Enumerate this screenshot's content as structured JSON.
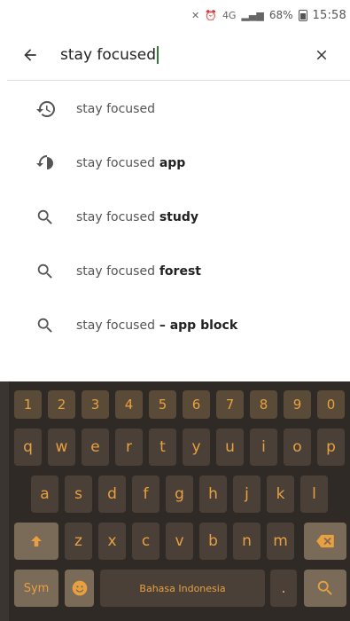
{
  "status": {
    "signal_text": "4G",
    "battery_percent": "68%",
    "time": "15:58"
  },
  "search": {
    "query": "stay focused"
  },
  "suggestions": [
    {
      "type": "history",
      "prefix": "stay focused",
      "suffix": ""
    },
    {
      "type": "history",
      "prefix": "stay focused",
      "suffix": " app"
    },
    {
      "type": "search",
      "prefix": "stay focused",
      "suffix": " study"
    },
    {
      "type": "search",
      "prefix": "stay focused",
      "suffix": " forest"
    },
    {
      "type": "search",
      "prefix": "stay focused",
      "suffix": " – app block"
    }
  ],
  "keyboard": {
    "row_numbers": [
      "1",
      "2",
      "3",
      "4",
      "5",
      "6",
      "7",
      "8",
      "9",
      "0"
    ],
    "row_top": [
      "q",
      "w",
      "e",
      "r",
      "t",
      "y",
      "u",
      "i",
      "o",
      "p"
    ],
    "row_mid": [
      "a",
      "s",
      "d",
      "f",
      "g",
      "h",
      "j",
      "k",
      "l"
    ],
    "row_bottom": [
      "z",
      "x",
      "c",
      "v",
      "b",
      "n",
      "m"
    ],
    "sym_label": "Sym",
    "space_label": "Bahasa Indonesia",
    "period_label": "."
  },
  "colors": {
    "accent_green": "#2e7d32",
    "keyboard_bg": "#2f2a26",
    "key_text": "#e8a040"
  }
}
